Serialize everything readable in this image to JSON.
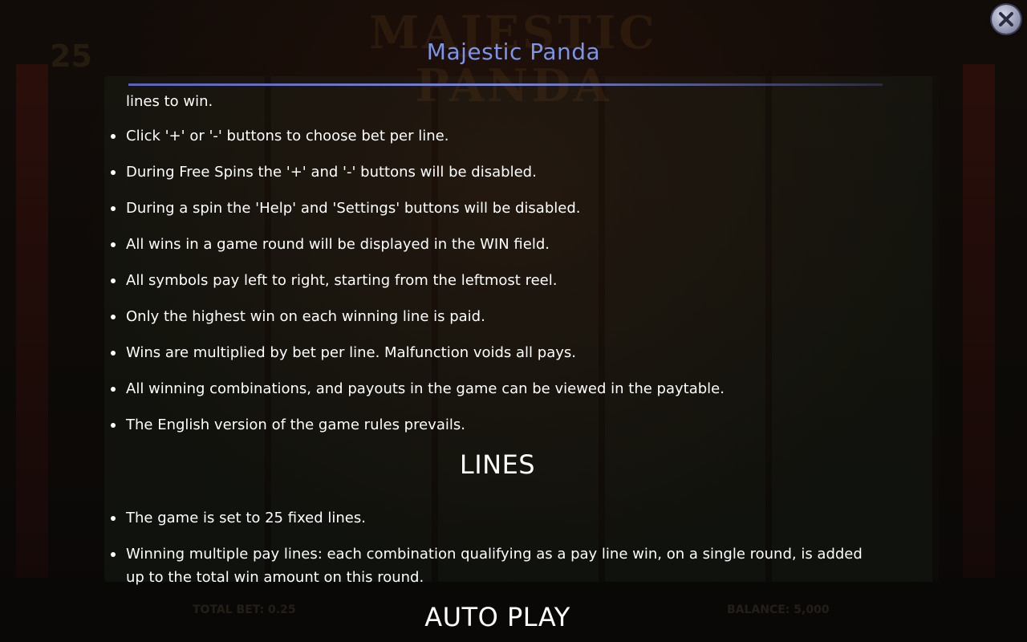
{
  "background": {
    "game_title": "MAJESTIC PANDA",
    "lines_count": "25",
    "total_bet": "TOTAL BET: 0.25",
    "balance": "BALANCE: 5,000"
  },
  "dialog": {
    "title": "Majestic Panda",
    "close_icon": "close-icon",
    "accent_color": "#7d94e8"
  },
  "rules": {
    "fragment": "lines to win.",
    "items": [
      "Click '+' or '-' buttons to choose bet per line.",
      "During Free Spins the '+' and '-' buttons will be disabled.",
      "During a spin the 'Help' and 'Settings' buttons will be disabled.",
      "All wins in a game round will be displayed in the WIN field.",
      "All symbols pay left to right, starting from the leftmost reel.",
      "Only the highest win on each winning line is paid.",
      "Wins are multiplied by bet per line. Malfunction voids all pays.",
      "All winning combinations, and payouts in the game can be viewed in the paytable.",
      "The English version of the game rules prevails."
    ]
  },
  "lines": {
    "heading": "LINES",
    "items": [
      "The game is set to 25 fixed lines.",
      "Winning multiple pay lines: each combination qualifying as a pay line win, on a single round, is added up to the total win amount on this round."
    ]
  },
  "auto_play": {
    "heading": "AUTO PLAY"
  }
}
